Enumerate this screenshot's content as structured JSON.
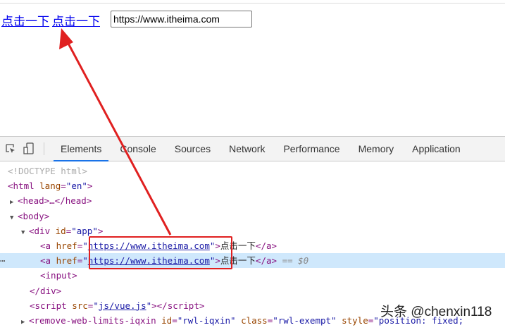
{
  "page": {
    "links": [
      "点击一下",
      "点击一下"
    ],
    "input_value": "https://www.itheima.com"
  },
  "devtools": {
    "tabs": [
      "Elements",
      "Console",
      "Sources",
      "Network",
      "Performance",
      "Memory",
      "Application"
    ],
    "active_tab": "Elements",
    "code": {
      "doctype": "<!DOCTYPE html>",
      "html_tag": "<html ",
      "lang_attr": "lang",
      "lang_val": "\"en\"",
      "close": ">",
      "head": "<head>…</head>",
      "body": "<body>",
      "div_open": "<div ",
      "id_attr": "id",
      "id_val": "\"app\"",
      "a_open": "<a ",
      "href_attr": "href",
      "href_q": "\"",
      "href_val": "https://www.itheima.com",
      "a_text": "点击一下",
      "a_close": "</a>",
      "selected_marker": "== $0",
      "input": "<input>",
      "div_close": "</div>",
      "script_open": "<script ",
      "src_attr": "src",
      "src_val": "js/vue.js",
      "script_close": "></script>",
      "remove_tag": "<remove-web-limits-iqxin ",
      "rid_val": "\"rwl-iqxin\"",
      "class_attr": "class",
      "class_val": "\"rwl-exempt\"",
      "style_attr": "style",
      "style_val": "\"position: fixed;"
    }
  },
  "watermark": "头条 @chenxin118",
  "colors": {
    "accent": "#1a73e8",
    "annotation": "#e02020",
    "selection": "#cfe8fc"
  }
}
